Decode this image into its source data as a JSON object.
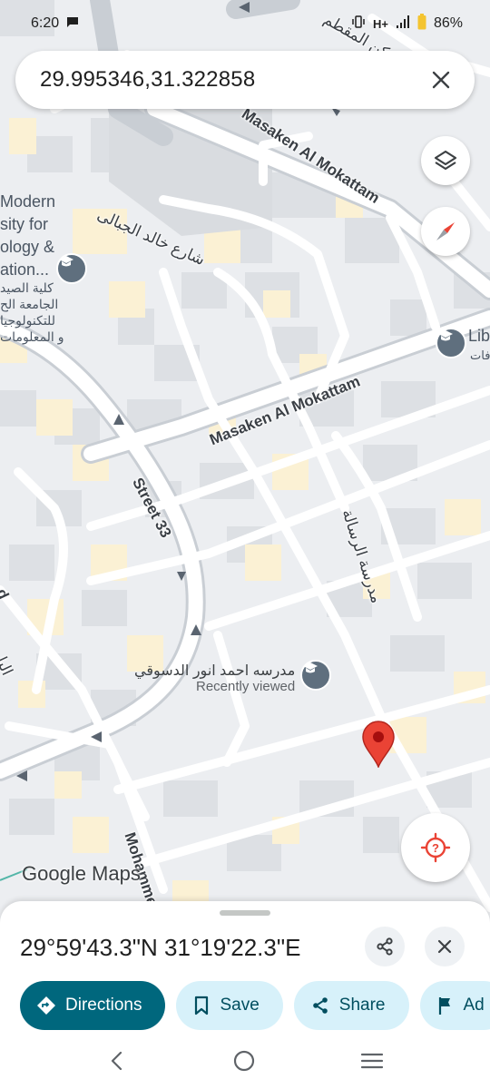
{
  "status": {
    "time": "6:20",
    "network": "H+",
    "battery": "86%"
  },
  "search": {
    "query": "29.995346,31.322858"
  },
  "map": {
    "labels": {
      "road1": "Masaken Al Mokattam",
      "road2": "Masaken Al Mokattam",
      "road3": "Street 33",
      "road4": "Mohammed",
      "road_ar1": "شارع خالد الجبالى",
      "road_ar2": "مدرسة الرسالة",
      "poi1_line1": "Modern",
      "poi1_line2": "sity for",
      "poi1_line3": "ology &",
      "poi1_line4": "ation...",
      "poi1_ar1": "كلية الصيد",
      "poi1_ar2": "الجامعة الح",
      "poi1_ar3": "للتكنولوجيا",
      "poi1_ar4": "و المعلومات",
      "poi2_name": "مدرسه احمد انور الدسوقي",
      "poi2_sub": "Recently viewed",
      "poi3_name": "Lib",
      "poi3_ar": "فات",
      "top_ar": "كن المقطم",
      "left_ar": "اليا",
      "left_d": "d"
    },
    "logo": "Google Maps"
  },
  "sheet": {
    "coords": "29°59'43.3\"N 31°19'22.3\"E",
    "actions": {
      "directions": "Directions",
      "save": "Save",
      "share": "Share",
      "add": "Ad"
    }
  },
  "colors": {
    "accent": "#00677d",
    "chip": "#d7f1fa",
    "pin": "#ea4335"
  }
}
